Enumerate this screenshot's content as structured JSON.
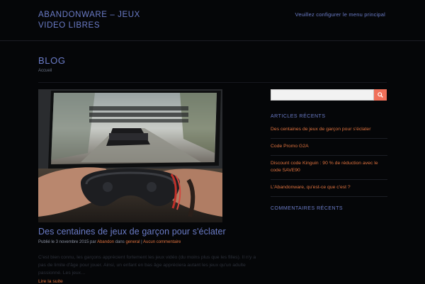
{
  "header": {
    "site_title": "ABANDONWARE – JEUX VIDEO LIBRES",
    "menu_notice": "Veuillez configurer le menu principal"
  },
  "page": {
    "heading": "BLOG",
    "breadcrumb": "Accueil"
  },
  "post": {
    "title": "Des centaines de jeux de garçon pour s'éclater",
    "meta_prefix": "Publié le 3 novembre 2015 par ",
    "author": "Abandon",
    "meta_in": " dans ",
    "category": "general",
    "meta_sep": " | ",
    "comments": "Aucun commentaire",
    "excerpt": "C'est bien connu, les garçons apprécient fortement les jeux vidéo (du moins plus que les filles). Il n'y a pas de limite d'âge pour jouer. Ainsi, un enfant en bas âge appréciera autant les jeux qu'un adulte passionné. Les jeux…",
    "read_more": "Lire la suite"
  },
  "sidebar": {
    "search_placeholder": "",
    "recent_title": "ARTICLES RÉCENTS",
    "recent_items": [
      "Des centaines de jeux de garçon pour s'éclater",
      "Code Promo G2A",
      "Discount code Kinguin : 90 % de réduction avec le code SAVE90",
      "L'Abandonware, qu'est-ce que c'est ?"
    ],
    "comments_title": "COMMENTAIRES RÉCENTS"
  },
  "colors": {
    "accent_link": "#e0733f",
    "title_blue": "#6b7cc8",
    "search_button": "#f0705a"
  },
  "icons": {
    "search": "search-icon"
  }
}
